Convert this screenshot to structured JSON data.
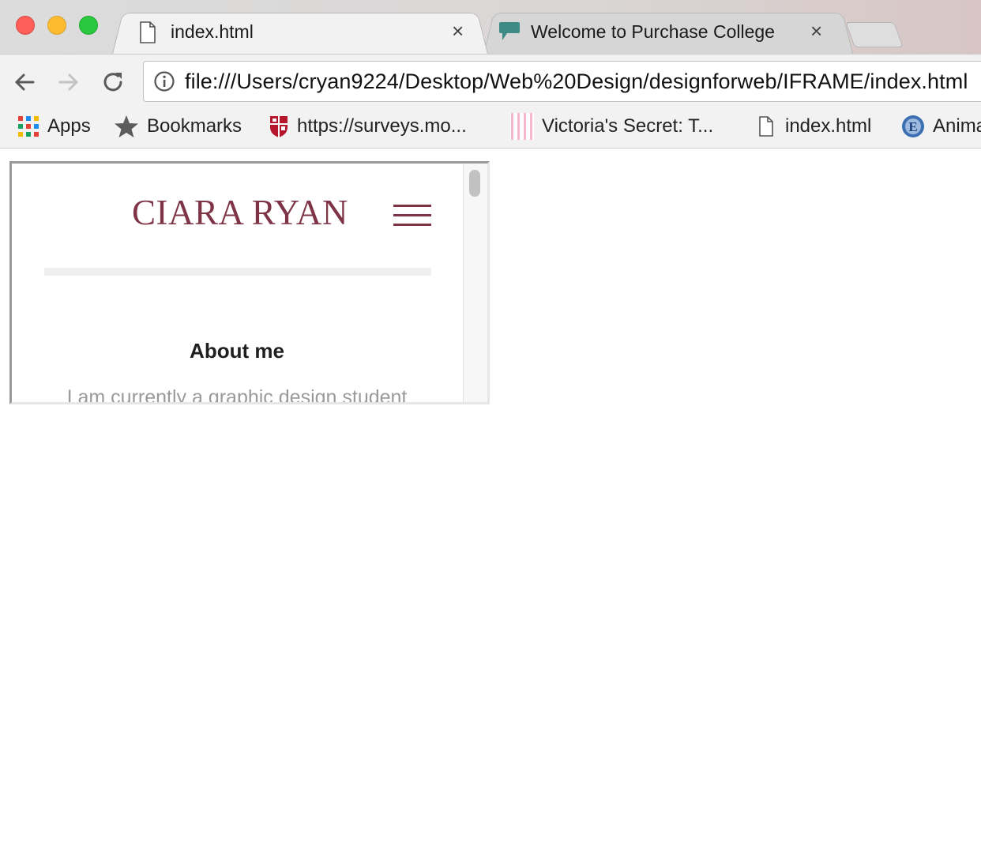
{
  "browser": {
    "tabs": [
      {
        "title": "index.html",
        "icon": "document-icon",
        "active": true
      },
      {
        "title": "Welcome to Purchase College",
        "icon": "speech-bubble-icon",
        "active": false
      }
    ],
    "close_glyph": "×",
    "url": "file:///Users/cryan9224/Desktop/Web%20Design/designforweb/IFRAME/index.html",
    "bookmarks": [
      {
        "label": "Apps",
        "icon": "apps-grid-icon"
      },
      {
        "label": "Bookmarks",
        "icon": "star-icon"
      },
      {
        "label": "https://surveys.mo...",
        "icon": "shield-crest-icon"
      },
      {
        "label": "Victoria's Secret: T...",
        "icon": "pink-stripes-icon"
      },
      {
        "label": "index.html",
        "icon": "document-icon"
      },
      {
        "label": "Anima",
        "icon": "letter-e-globe-icon"
      }
    ]
  },
  "site": {
    "title": "CIARA RYAN",
    "about_heading": "About me",
    "about_text": "I am currently a graphic design student",
    "accent_color": "#7e3446"
  }
}
